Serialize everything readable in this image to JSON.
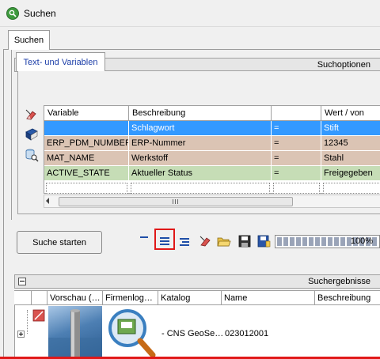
{
  "window": {
    "title": "Suchen"
  },
  "tabs": {
    "main": "Suchen",
    "sub": "Text- und Variablen"
  },
  "search_options": {
    "header": "Suchoptionen"
  },
  "grid": {
    "columns": [
      "Variable",
      "Beschreibung",
      "",
      "Wert / von"
    ],
    "rows": [
      {
        "variable": "",
        "beschreibung": "Schlagwort",
        "op": "=",
        "wert": "Stift",
        "selected": true
      },
      {
        "variable": "ERP_PDM_NUMBER",
        "beschreibung": "ERP-Nummer",
        "op": "=",
        "wert": "12345",
        "color": "#dbc4b4"
      },
      {
        "variable": "MAT_NAME",
        "beschreibung": "Werkstoff",
        "op": "=",
        "wert": "Stahl",
        "color": "#dbc4b4"
      },
      {
        "variable": "ACTIVE_STATE",
        "beschreibung": "Aktueller Status",
        "op": "=",
        "wert": "Freigegeben",
        "color": "#c6ddb6"
      }
    ],
    "selected_color": "#3399ff"
  },
  "toolbar": {
    "search_button": "Suche starten",
    "progress_value": 100,
    "progress_text": "100%"
  },
  "results": {
    "header": "Suchergebnisse",
    "columns": [
      "Vorschau (…",
      "Firmenlog…",
      "Katalog",
      "Name",
      "Beschreibung"
    ],
    "row": {
      "katalog": "- CNS GeoSe…",
      "name": "023012001"
    }
  },
  "icons": {
    "toolcol": [
      "eraser-icon",
      "book-icon",
      "database-search-icon"
    ],
    "toolbar": [
      "minus-icon",
      "list-center-icon",
      "list-right-icon",
      "eraser-icon",
      "open-folder-icon",
      "save-icon",
      "save-as-icon"
    ]
  }
}
